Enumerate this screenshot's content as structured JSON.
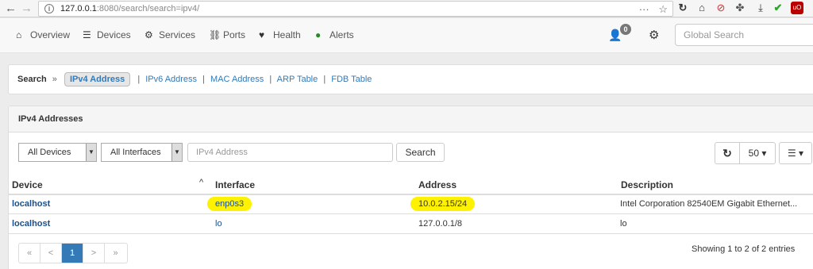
{
  "browser": {
    "url_host": "127.0.0.1",
    "url_rest": ":8080/search/search=ipv4/",
    "info_glyph": "i",
    "back_glyph": "←",
    "forward_glyph": "→",
    "more_glyph": "···",
    "star_glyph": "☆"
  },
  "navbar": {
    "items": [
      {
        "label": "Overview",
        "icon": "home-icon",
        "glyph": "⌂"
      },
      {
        "label": "Devices",
        "icon": "server-icon",
        "glyph": "☰"
      },
      {
        "label": "Services",
        "icon": "cogs-icon",
        "glyph": "⚙"
      },
      {
        "label": "Ports",
        "icon": "link-icon",
        "glyph": "⛓"
      },
      {
        "label": "Health",
        "icon": "heartbeat-icon",
        "glyph": "♥"
      },
      {
        "label": "Alerts",
        "icon": "exclamation-circle-icon",
        "glyph": "●"
      }
    ],
    "user_glyph": "👤",
    "notification_count": "0",
    "settings_glyph": "⚙",
    "search_placeholder": "Global Search"
  },
  "breadcrumb": {
    "title": "Search",
    "sep": "»",
    "active": "IPv4 Address",
    "links": [
      "IPv6 Address",
      "MAC Address",
      "ARP Table",
      "FDB Table"
    ],
    "divider": "|"
  },
  "panel": {
    "title": "IPv4 Addresses",
    "devices_select": "All Devices",
    "interfaces_select": "All Interfaces",
    "address_placeholder": "IPv4 Address",
    "search_button": "Search",
    "refresh_glyph": "↻",
    "page_size": "50 ▾",
    "columns_glyph": "☰ ▾",
    "select_arrow": "▼"
  },
  "table": {
    "headers": [
      "Device",
      "Interface",
      "Address",
      "Description"
    ],
    "sort_glyph": "^",
    "rows": [
      {
        "device": "localhost",
        "interface": "enp0s3",
        "address": "10.0.2.15/24",
        "description": "Intel Corporation 82540EM Gigabit Ethernet..."
      },
      {
        "device": "localhost",
        "interface": "lo",
        "address": "127.0.0.1/8",
        "description": "lo"
      }
    ]
  },
  "pagination": {
    "first": "«",
    "prev": "<",
    "current": "1",
    "next": ">",
    "last": "»",
    "summary": "Showing 1 to 2 of 2 entries"
  },
  "colors": {
    "link": "#337ab7",
    "highlight": "#fff200",
    "active_page": "#337ab7"
  }
}
